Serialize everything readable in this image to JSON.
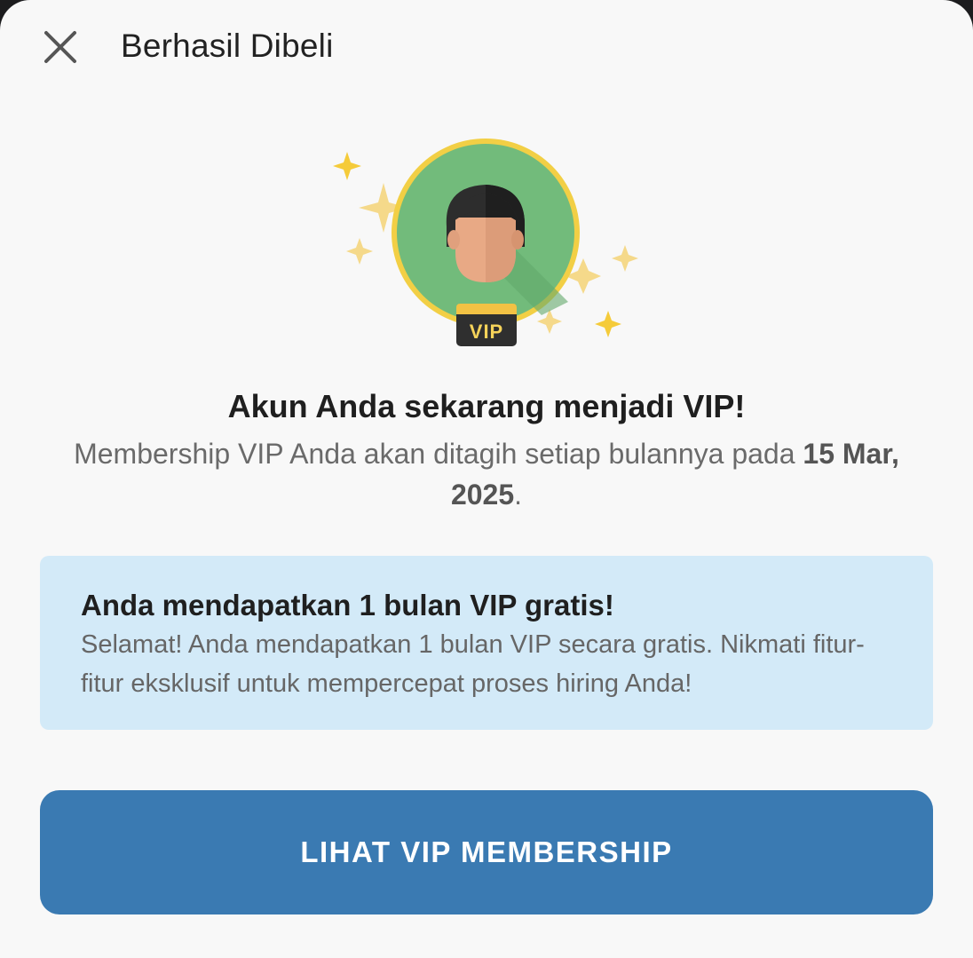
{
  "header": {
    "title": "Berhasil Dibeli",
    "close_icon": "close-icon"
  },
  "illustration": {
    "badge_label": "VIP",
    "avatar_icon": "user-avatar-icon",
    "sparkle_icon": "sparkle-icon"
  },
  "message": {
    "headline": "Akun Anda sekarang menjadi VIP!",
    "subtext_prefix": "Membership VIP Anda akan ditagih setiap bulannya pada ",
    "billing_date": "15 Mar, 2025",
    "subtext_suffix": "."
  },
  "info_box": {
    "title": "Anda mendapatkan 1 bulan VIP gratis!",
    "body": "Selamat! Anda mendapatkan 1 bulan VIP secara gratis. Nikmati fitur-fitur eksklusif untuk mempercepat proses hiring Anda!"
  },
  "cta": {
    "label": "LIHAT VIP MEMBERSHIP"
  },
  "colors": {
    "accent": "#3a7ab2",
    "info_bg": "#d3eaf8",
    "avatar_bg": "#72bb7b",
    "ring": "#f2cf45",
    "badge": "#2f2f2f"
  }
}
